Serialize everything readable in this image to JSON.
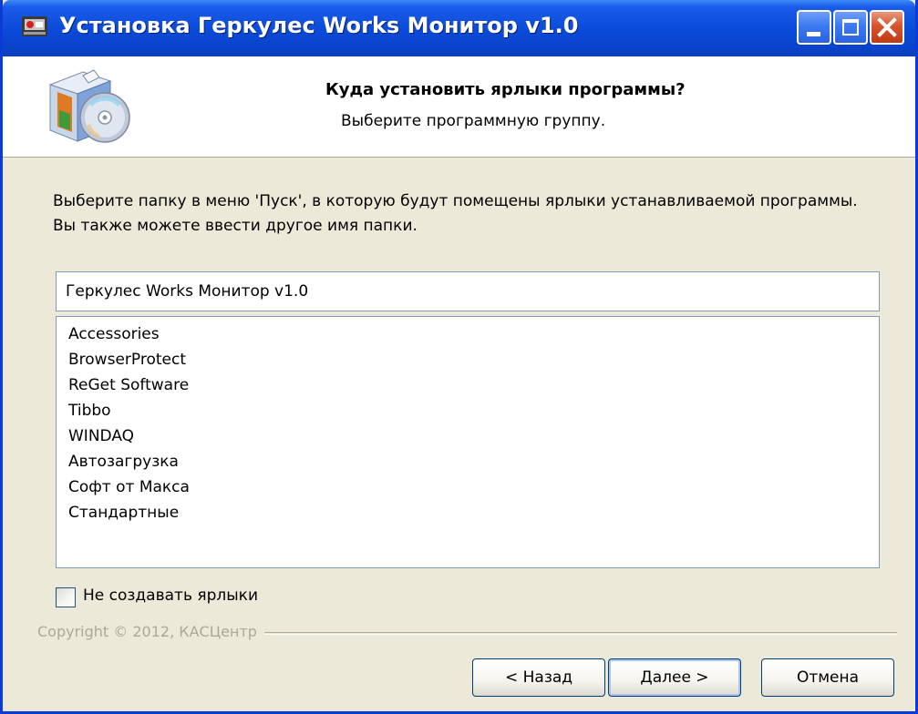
{
  "window": {
    "title": "Установка Геркулес Works Монитор v1.0"
  },
  "header": {
    "title": "Куда установить ярлыки программы?",
    "subtitle": "Выберите программную группу.",
    "icon": "installer-box-cd-icon"
  },
  "instruction": "Выберите папку в меню 'Пуск', в которую будут помещены ярлыки устанавливаемой программы. Вы также можете ввести другое имя папки.",
  "folder_input": {
    "value": "Геркулес Works Монитор v1.0"
  },
  "folder_list": {
    "items": [
      "Accessories",
      "BrowserProtect",
      "ReGet Software",
      "Tibbo",
      "WINDAQ",
      "Автозагрузка",
      "Софт от Макса",
      "Стандартные"
    ]
  },
  "no_shortcuts_checkbox": {
    "label": "Не создавать ярлыки",
    "checked": false
  },
  "copyright": "Copyright © 2012, КАСЦентр",
  "buttons": {
    "back": "< Назад",
    "next": "Далее >",
    "cancel": "Отмена"
  },
  "colors": {
    "titlebar": "#0a4ad8",
    "dialog_bg": "#ece9d8",
    "close_button": "#d5542e"
  }
}
